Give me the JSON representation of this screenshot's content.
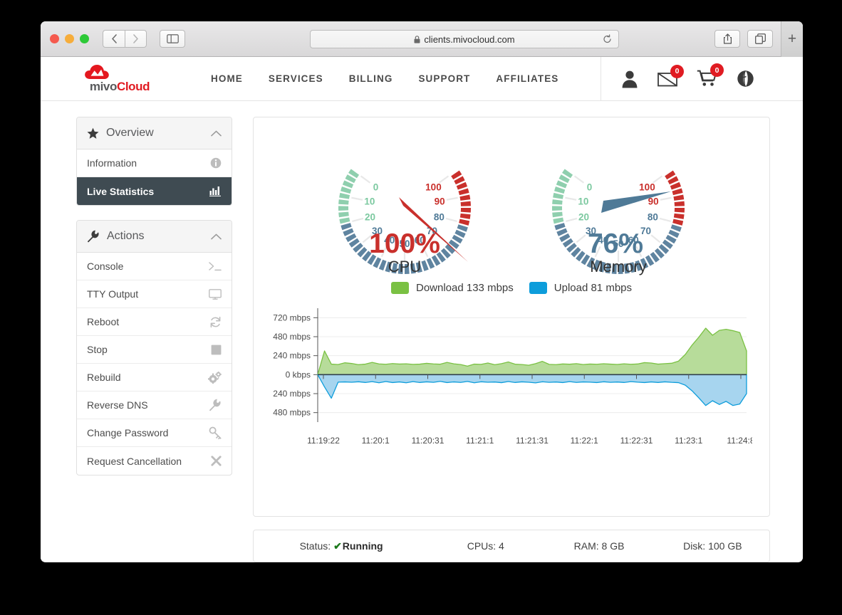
{
  "browser": {
    "url": "clients.mivocloud.com",
    "lock_icon": "lock-icon",
    "reload_icon": "reload-icon",
    "back_icon": "back-arrow-icon",
    "forward_icon": "forward-arrow-icon",
    "sidebar_icon": "sidebar-toggle-icon",
    "share_icon": "share-icon",
    "tabs_icon": "show-tabs-icon",
    "new_tab_label": "+"
  },
  "site": {
    "logo": {
      "part1": "mivo",
      "part2": "Cloud",
      "mark": "cloud-icon"
    },
    "nav": [
      {
        "label": "HOME"
      },
      {
        "label": "SERVICES"
      },
      {
        "label": "BILLING"
      },
      {
        "label": "SUPPORT"
      },
      {
        "label": "AFFILIATES"
      }
    ],
    "icons": [
      {
        "name": "account-icon",
        "badge": null
      },
      {
        "name": "messages-icon",
        "badge": "0"
      },
      {
        "name": "cart-icon",
        "badge": "0"
      },
      {
        "name": "globe-icon",
        "badge": null
      }
    ]
  },
  "sidebar": {
    "overview": {
      "title": "Overview",
      "icon": "star-icon",
      "chevron": "chevron-up-icon",
      "items": [
        {
          "label": "Information",
          "icon": "info-icon",
          "active": false
        },
        {
          "label": "Live Statistics",
          "icon": "bar-chart-icon",
          "active": true
        }
      ]
    },
    "actions": {
      "title": "Actions",
      "icon": "wrench-icon",
      "chevron": "chevron-up-icon",
      "items": [
        {
          "label": "Console",
          "icon": "terminal-icon"
        },
        {
          "label": "TTY Output",
          "icon": "monitor-icon"
        },
        {
          "label": "Reboot",
          "icon": "refresh-icon"
        },
        {
          "label": "Stop",
          "icon": "stop-square-icon"
        },
        {
          "label": "Rebuild",
          "icon": "gears-icon"
        },
        {
          "label": "Reverse DNS",
          "icon": "wrench-icon"
        },
        {
          "label": "Change Password",
          "icon": "key-icon"
        },
        {
          "label": "Request Cancellation",
          "icon": "close-x-icon"
        }
      ]
    }
  },
  "gauges": [
    {
      "id": "cpu",
      "caption": "CPU",
      "value": 100,
      "value_label": "100%",
      "needle_color": "#c9302c",
      "value_color": "#c9302c",
      "ticks": [
        "0",
        "10",
        "20",
        "30",
        "40",
        "50",
        "60",
        "70",
        "80",
        "90",
        "100"
      ]
    },
    {
      "id": "memory",
      "caption": "Memory",
      "value": 76,
      "value_label": "76%",
      "needle_color": "#4f7a97",
      "value_color": "#4f7a97",
      "ticks": [
        "0",
        "10",
        "20",
        "30",
        "40",
        "50",
        "60",
        "70",
        "80",
        "90",
        "100"
      ]
    }
  ],
  "gauge_palette": {
    "green": "#8fcfae",
    "blue": "#5f84a0",
    "red": "#c9302c",
    "tick_green": "#7cc9a0",
    "tick_blue": "#4f7a97",
    "tick_red": "#c9302c"
  },
  "legend": [
    {
      "label": "Download 133 mbps",
      "color": "#7ac143"
    },
    {
      "label": "Upload 81 mbps",
      "color": "#0d9ddb"
    }
  ],
  "chart_data": {
    "type": "area",
    "title": "",
    "xlabel": "",
    "ylabel": "",
    "ylim": [
      -600,
      840
    ],
    "ytick_values": [
      720,
      480,
      240,
      0,
      -240,
      -480
    ],
    "ytick_labels": [
      "720 mbps",
      "480 mbps",
      "240 mbps",
      "0 kbps",
      "240 mbps",
      "480 mbps"
    ],
    "xtick_labels": [
      "11:19:22",
      "11:20:1",
      "11:20:31",
      "11:21:1",
      "11:21:31",
      "11:22:1",
      "11:22:31",
      "11:23:1",
      "11:24:8"
    ],
    "grid": true,
    "legend_position": "top",
    "series": [
      {
        "name": "Download",
        "color": "#7ac143",
        "fill": "#b7dc9a",
        "values": [
          0,
          300,
          133,
          128,
          150,
          141,
          126,
          133,
          155,
          136,
          131,
          140,
          134,
          137,
          130,
          133,
          143,
          136,
          132,
          155,
          137,
          128,
          108,
          133,
          130,
          147,
          126,
          139,
          160,
          132,
          128,
          119,
          139,
          168,
          130,
          127,
          135,
          132,
          139,
          128,
          134,
          131,
          138,
          133,
          129,
          137,
          131,
          135,
          152,
          147,
          133,
          139,
          144,
          171,
          255,
          374,
          475,
          588,
          498,
          560,
          573,
          556,
          533,
          300
        ]
      },
      {
        "name": "Upload",
        "color": "#0d9ddb",
        "fill": "#a7d5ef",
        "values": [
          0,
          -155,
          -298,
          -95,
          -92,
          -96,
          -90,
          -99,
          -88,
          -103,
          -87,
          -100,
          -92,
          -103,
          -88,
          -99,
          -91,
          -97,
          -85,
          -100,
          -92,
          -98,
          -86,
          -103,
          -90,
          -96,
          -93,
          -101,
          -87,
          -99,
          -91,
          -96,
          -104,
          -90,
          -97,
          -93,
          -100,
          -88,
          -98,
          -92,
          -95,
          -100,
          -90,
          -97,
          -93,
          -99,
          -88,
          -95,
          -100,
          -92,
          -99,
          -91,
          -97,
          -101,
          -133,
          -205,
          -295,
          -390,
          -330,
          -377,
          -338,
          -390,
          -372,
          -240
        ]
      }
    ]
  },
  "status_bar": {
    "status_label": "Status:",
    "status_check": "✔",
    "status_value": "Running",
    "cpus": "CPUs: 4",
    "ram": "RAM: 8 GB",
    "disk": "Disk: 100 GB"
  }
}
